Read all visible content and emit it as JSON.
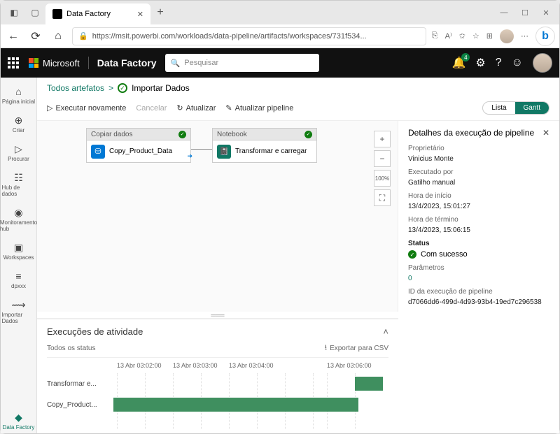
{
  "browser": {
    "tab_title": "Data Factory",
    "url": "https://msit.powerbi.com/workloads/data-pipeline/artifacts/workspaces/731f534..."
  },
  "appbar": {
    "company": "Microsoft",
    "product": "Data Factory",
    "search_placeholder": "Pesquisar",
    "notif_count": "4"
  },
  "rail": {
    "home": "Página inicial",
    "create": "Criar",
    "browse": "Procurar",
    "onelake": "Hub de dados",
    "monitor": "Monitoramento hub",
    "workspaces": "Workspaces",
    "dpxxx": "dpxxx",
    "import": "Importar Dados",
    "datafactory": "Data Factory"
  },
  "breadcrumb": {
    "root": "Todos artefatos",
    "sep": ">",
    "current": "Importar Dados"
  },
  "toolbar": {
    "rerun": "Executar novamente",
    "cancel": "Cancelar",
    "refresh": "Atualizar",
    "refresh_pipeline": "Atualizar pipeline",
    "list": "Lista",
    "gantt": "Gantt"
  },
  "canvas": {
    "copy": {
      "type": "Copiar dados",
      "name": "Copy_Product_Data"
    },
    "notebook": {
      "type": "Notebook",
      "name": "Transformar e carregar"
    }
  },
  "activity": {
    "title": "Execuções de atividade",
    "filter": "Todos os status",
    "export": "Exportar para CSV",
    "times": {
      "t1": "13 Abr 03:02:00",
      "t2": "13 Abr 03:03:00",
      "t3": "13 Abr 03:04:00",
      "t4": "13 Abr 03:06:00"
    },
    "row1": "Transformar e...",
    "row2": "Copy_Product..."
  },
  "details": {
    "title": "Detalhes da execução de pipeline",
    "owner_label": "Proprietário",
    "owner_val": "Vinicius Monte",
    "runby_label": "Executado por",
    "runby_val": "Gatilho manual",
    "start_label": "Hora de início",
    "start_val": "13/4/2023, 15:01:27",
    "end_label": "Hora de término",
    "end_val": "13/4/2023, 15:06:15",
    "status_label": "Status",
    "status_val": "Com sucesso",
    "params_label": "Parâmetros",
    "params_val": "0",
    "runid_label": "ID da execução de pipeline",
    "runid_val": "d7066dd6-499d-4d93-93b4-19ed7c296538"
  }
}
